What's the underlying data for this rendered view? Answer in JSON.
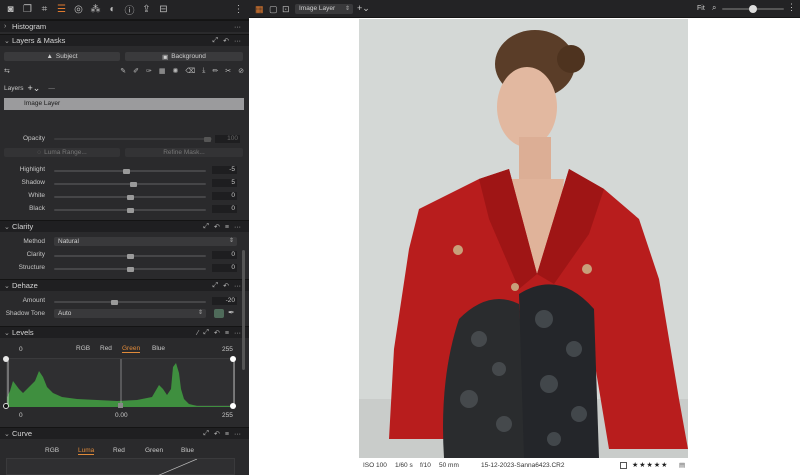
{
  "toolbar": {
    "icons": [
      "camera-icon",
      "library-icon",
      "sliders-icon",
      "lens-icon",
      "color-circles-icon",
      "exposure-icon",
      "info-icon",
      "export-icon",
      "adjustments-icon"
    ],
    "more": "⋮"
  },
  "histogram": {
    "title": "Histogram"
  },
  "layers_masks": {
    "title": "Layers & Masks",
    "subject_btn": "Subject",
    "background_btn": "Background",
    "layers_label": "Layers",
    "selected_layer": "Image Layer",
    "opacity_label": "Opacity",
    "opacity_value": "100",
    "luma_range_btn": "Luma Range...",
    "refine_mask_btn": "Refine Mask..."
  },
  "exposure": {
    "rows": [
      {
        "label": "Highlight",
        "value": "-5",
        "pos": 0.48
      },
      {
        "label": "Shadow",
        "value": "5",
        "pos": 0.52
      },
      {
        "label": "White",
        "value": "0",
        "pos": 0.5
      },
      {
        "label": "Black",
        "value": "0",
        "pos": 0.5
      }
    ]
  },
  "clarity": {
    "title": "Clarity",
    "method_label": "Method",
    "method_value": "Natural",
    "rows": [
      {
        "label": "Clarity",
        "value": "0",
        "pos": 0.5
      },
      {
        "label": "Structure",
        "value": "0",
        "pos": 0.5
      }
    ]
  },
  "dehaze": {
    "title": "Dehaze",
    "amount_label": "Amount",
    "amount_value": "-20",
    "amount_pos": 0.4,
    "shadow_tone_label": "Shadow Tone",
    "shadow_tone_value": "Auto",
    "swatch_color": "#4f6b5a"
  },
  "levels": {
    "title": "Levels",
    "channels": [
      "RGB",
      "Red",
      "Green",
      "Blue"
    ],
    "active_channel": "Green",
    "in_low": "0",
    "in_high": "255",
    "mid": "0.00",
    "out_low": "0",
    "out_high": "255",
    "histogram_color": "#3f8f3f"
  },
  "curve": {
    "title": "Curve",
    "channels": [
      "RGB",
      "Luma",
      "Red",
      "Green",
      "Blue"
    ],
    "active_channel": "Luma"
  },
  "topbar": {
    "layer_select": "Image Layer",
    "fit_label": "Fit",
    "zoom_fraction": 0.5
  },
  "status": {
    "iso": "ISO 100",
    "shutter": "1/60 s",
    "aperture": "f/10",
    "focal": "50 mm",
    "filename": "15-12-2023-Sanna6423.CR2",
    "rating": 5
  },
  "colors": {
    "accent": "#e07a2e",
    "jacket": "#b81d1d",
    "background_wall": "#d4d8d6"
  }
}
